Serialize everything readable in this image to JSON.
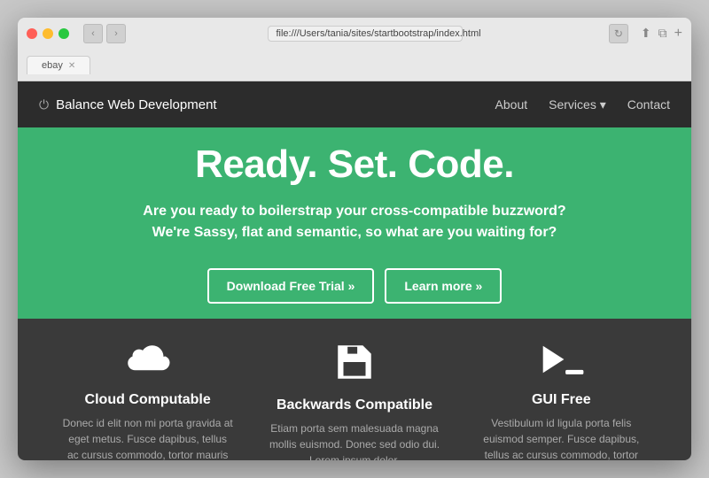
{
  "browser": {
    "tab_label": "ebay",
    "address": "file:///Users/tania/sites/startbootstrap/index.html"
  },
  "navbar": {
    "brand": "Balance Web Development",
    "links": [
      {
        "label": "About"
      },
      {
        "label": "Services ▾"
      },
      {
        "label": "Contact"
      }
    ]
  },
  "hero": {
    "title": "Ready. Set. Code.",
    "subtitle": "Are you ready to boilerstrap your cross-compatible buzzword? We're Sassy, flat and semantic, so what are you waiting for?",
    "btn_download": "Download Free Trial »",
    "btn_learn": "Learn more »"
  },
  "features": [
    {
      "title": "Cloud Computable",
      "text": "Donec id elit non mi porta gravida at eget metus. Fusce dapibus, tellus ac cursus commodo, tortor mauris condimentum"
    },
    {
      "title": "Backwards Compatible",
      "text": "Etiam porta sem malesuada magna mollis euismod. Donec sed odio dui. Lorem ipsum dolor."
    },
    {
      "title": "GUI Free",
      "text": "Vestibulum id ligula porta felis euismod semper. Fusce dapibus, tellus ac cursus commodo, tortor mauris condimentum"
    }
  ]
}
